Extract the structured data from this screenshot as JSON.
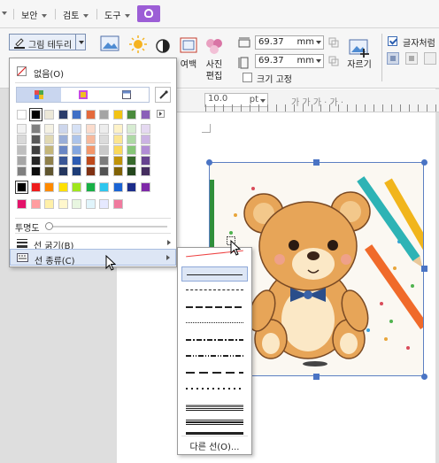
{
  "menubar": {
    "items": [
      {
        "label": "보안"
      },
      {
        "label": "검토"
      },
      {
        "label": "도구"
      }
    ],
    "active_tab_icon": "picture-tools-icon"
  },
  "ribbon": {
    "border_button": {
      "label": "그림 테두리",
      "icon": "pen-line-icon"
    },
    "margin_label": "여백",
    "photo_edit_label": "사진\n편집",
    "width_value": "69.37",
    "height_value": "69.37",
    "unit": "mm",
    "fixed_size_label": "크기 고정",
    "arrange_label": "자르기",
    "char_like_label": "글자처럼",
    "char_like_checked": true
  },
  "ruler": {
    "pt_value": "10.0",
    "pt_unit": "pt",
    "text_tools": "가 가 가 · 가 ·"
  },
  "dropdown": {
    "none_label": "없음(O)",
    "opacity_label": "투명도",
    "opacity_value": 0.0,
    "line_thickness_label": "선 굵기(B)",
    "line_type_label": "선 종류(C)",
    "theme_colors": [
      [
        "#ffffff",
        "#000000",
        "#ece8d8",
        "#2b3c6a",
        "#3f6fc6",
        "#e46a3c",
        "#a4a4a4",
        "#f2c314",
        "#4a8a3c",
        "#8a5fb8"
      ]
    ],
    "tint_columns": [
      [
        "#f2f2f2",
        "#d9d9d9",
        "#bfbfbf",
        "#a6a6a6",
        "#7f7f7f"
      ],
      [
        "#7f7f7f",
        "#595959",
        "#3f3f3f",
        "#262626",
        "#0d0d0d"
      ],
      [
        "#f5f2e4",
        "#e1d9b3",
        "#c4b67a",
        "#8f804b",
        "#5f552f"
      ],
      [
        "#cdd6ec",
        "#9aaed8",
        "#6a86c4",
        "#3a5696",
        "#24365e"
      ],
      [
        "#d6e1f5",
        "#adc4ea",
        "#84a6df",
        "#2d5cb3",
        "#1d3c77"
      ],
      [
        "#fbdccd",
        "#f7b99c",
        "#f3976b",
        "#bf4a1c",
        "#7f3113"
      ],
      [
        "#ededed",
        "#dbdbdb",
        "#c9c9c9",
        "#7b7b7b",
        "#525252"
      ],
      [
        "#fdf2c8",
        "#fbe592",
        "#f9d85b",
        "#c09308",
        "#806205"
      ],
      [
        "#d7ecd2",
        "#aed9a5",
        "#86c678",
        "#376a2c",
        "#24461d"
      ],
      [
        "#e5d9f1",
        "#cbb3e3",
        "#b18dd5",
        "#66438f",
        "#442d5f"
      ]
    ],
    "standard_colors": [
      "#000000",
      "#ee1c1c",
      "#ff8a00",
      "#ffe000",
      "#9fe61c",
      "#18b046",
      "#2ec6ee",
      "#1a64d4",
      "#1c2d8a",
      "#7e29a8"
    ],
    "recent_colors": [
      "#e4126a",
      "#ff9da0",
      "#fff0a8",
      "#fff7cc",
      "#e8f6e0",
      "#e0f4fb",
      "#e6e9ff",
      "#f07a9e"
    ]
  },
  "submenu": {
    "other_lines_label": "다른 선(O)...",
    "line_styles": [
      "none",
      "solid",
      "dash",
      "dot-dash-long",
      "dotted-fine",
      "dash-dot",
      "dash-dot-dot",
      "long-dash",
      "dotted",
      "double-thin",
      "thick",
      "double-thick",
      "triple"
    ]
  }
}
